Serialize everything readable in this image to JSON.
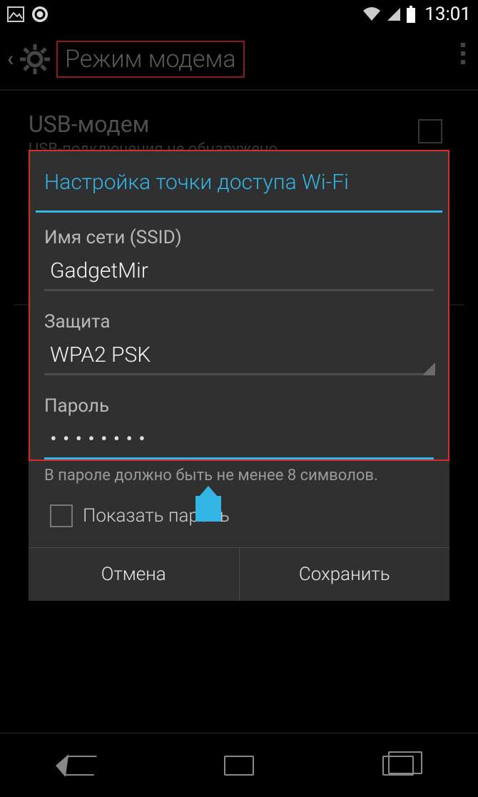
{
  "status": {
    "time": "13:01"
  },
  "header": {
    "title": "Режим модема"
  },
  "bgSection": {
    "usb_title": "USB-модем",
    "usb_sub": "USB-подключения не обнаружено"
  },
  "dialog": {
    "title": "Настройка точки доступа Wi-Fi",
    "ssid_label": "Имя сети (SSID)",
    "ssid_value": "GadgetMir",
    "security_label": "Защита",
    "security_value": "WPA2 PSK",
    "password_label": "Пароль",
    "password_masked": "••••••••",
    "password_hint": "В пароле должно быть не менее 8 символов.",
    "show_password_label": "Показать пароль",
    "cancel": "Отмена",
    "save": "Сохранить"
  }
}
